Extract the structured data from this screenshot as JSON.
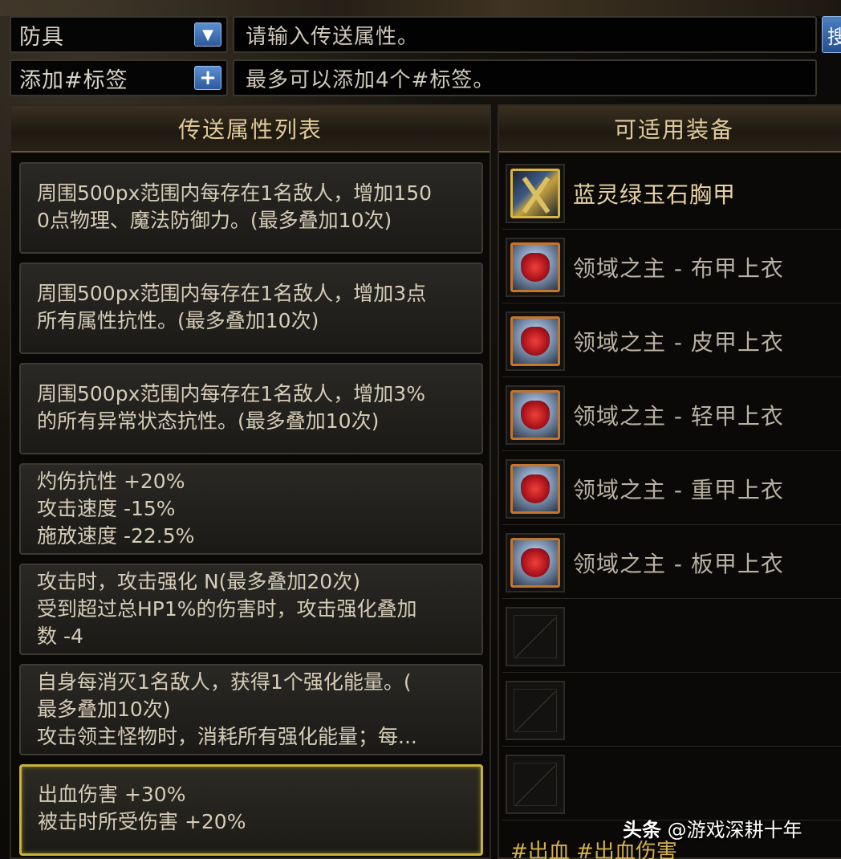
{
  "filter": {
    "category": "防具",
    "attribute_placeholder": "请输入传送属性。",
    "search_label": "搜",
    "tag_label": "添加#标签",
    "tag_placeholder": "最多可以添加4个#标签。"
  },
  "properties_panel": {
    "header": "传送属性列表",
    "items": [
      {
        "lines": [
          "周围500px范围内每存在1名敌人，增加150",
          "0点物理、魔法防御力。(最多叠加10次)"
        ]
      },
      {
        "lines": [
          "周围500px范围内每存在1名敌人，增加3点",
          "所有属性抗性。(最多叠加10次)"
        ]
      },
      {
        "lines": [
          "周围500px范围内每存在1名敌人，增加3%",
          "的所有异常状态抗性。(最多叠加10次)"
        ]
      },
      {
        "lines": [
          "灼伤抗性 +20%",
          "攻击速度 -15%",
          "施放速度 -22.5%"
        ]
      },
      {
        "lines": [
          "攻击时，攻击强化 N(最多叠加20次)",
          "受到超过总HP1%的伤害时，攻击强化叠加",
          "数 -4"
        ]
      },
      {
        "lines": [
          "自身每消灭1名敌人，获得1个强化能量。(",
          "最多叠加10次)",
          "攻击领主怪物时，消耗所有强化能量；每..."
        ]
      },
      {
        "lines": [
          "出血伤害 +30%",
          "被击时所受伤害 +20%"
        ],
        "selected": true
      }
    ]
  },
  "equipment_panel": {
    "header": "可适用装备",
    "items": [
      {
        "name": "蓝灵绿玉石胸甲",
        "icon": "gold-chest-armor-icon"
      },
      {
        "name": "领域之主 - 布甲上衣",
        "icon": "red-chest-armor-icon"
      },
      {
        "name": "领域之主 - 皮甲上衣",
        "icon": "red-chest-armor-icon"
      },
      {
        "name": "领域之主 - 轻甲上衣",
        "icon": "red-chest-armor-icon"
      },
      {
        "name": "领域之主 - 重甲上衣",
        "icon": "red-chest-armor-icon"
      },
      {
        "name": "领域之主 - 板甲上衣",
        "icon": "red-chest-armor-icon"
      },
      {
        "name": "",
        "icon": "empty-slot-icon"
      },
      {
        "name": "",
        "icon": "empty-slot-icon"
      },
      {
        "name": "",
        "icon": "empty-slot-icon"
      }
    ],
    "tags": "#出血 #出血伤害"
  },
  "watermark": {
    "platform": "头条",
    "author": "@游戏深耕十年"
  }
}
